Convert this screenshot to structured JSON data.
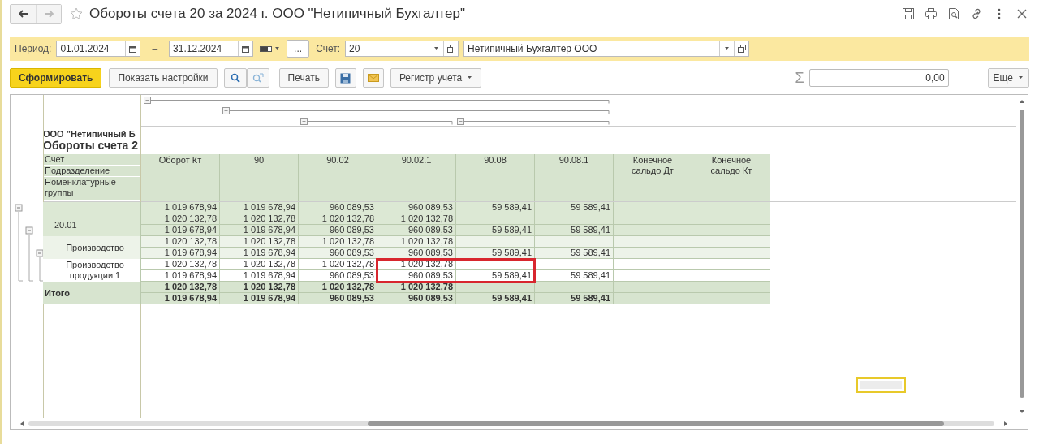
{
  "window": {
    "title": "Обороты счета 20 за 2024 г. ООО \"Нетипичный Бухгалтер\""
  },
  "filters": {
    "period_label": "Период:",
    "date_from": "01.01.2024",
    "separator": "–",
    "date_to": "31.12.2024",
    "more_button": "...",
    "account_label": "Счет:",
    "account": "20",
    "organization": "Нетипичный Бухгалтер ООО"
  },
  "toolbar": {
    "buttons": [
      {
        "kind": "primary",
        "label": "Сформировать"
      },
      {
        "kind": "text",
        "label": "Показать настройки"
      },
      {
        "kind": "search"
      },
      {
        "kind": "findnext"
      },
      {
        "kind": "text",
        "label": "Печать"
      },
      {
        "kind": "save"
      },
      {
        "kind": "mail"
      },
      {
        "kind": "menu",
        "label": "Регистр учета"
      }
    ],
    "sum_sign": "Σ",
    "sum_value": "0,00",
    "more_menu": "Еще"
  },
  "report": {
    "company": "ООО \"Нетипичный Б",
    "title": "Обороты счета 2",
    "row_headers": [
      "Счет",
      "Подразделение",
      "Номенклатурные группы"
    ],
    "columns": [
      "Оборот Кт",
      "90",
      "90.02",
      "90.02.1",
      "90.08",
      "90.08.1",
      "Конечное сальдо Дт",
      "Конечное сальдо Кт"
    ],
    "rows": [
      {
        "expanded": true,
        "lines": [
          [
            "1 019 678,94",
            "1 019 678,94",
            "960 089,53",
            "960 089,53",
            "59 589,41",
            "59 589,41"
          ]
        ],
        "children": [
          {
            "label": "20.01",
            "expanded": true,
            "lines": [
              [
                "1 020 132,78",
                "1 020 132,78",
                "1 020 132,78",
                "1 020 132,78"
              ],
              [
                "1 019 678,94",
                "1 019 678,94",
                "960 089,53",
                "960 089,53",
                "59 589,41",
                "59 589,41"
              ]
            ],
            "children": [
              {
                "label": "Производство",
                "expanded": true,
                "lines": [
                  [
                    "1 020 132,78",
                    "1 020 132,78",
                    "1 020 132,78",
                    "1 020 132,78"
                  ],
                  [
                    "1 019 678,94",
                    "1 019 678,94",
                    "960 089,53",
                    "960 089,53",
                    "59 589,41",
                    "59 589,41"
                  ]
                ],
                "children": [
                  {
                    "label": "Производство продукции 1",
                    "lines": [
                      [
                        "1 020 132,78",
                        "1 020 132,78",
                        "1 020 132,78",
                        "1 020 132,78"
                      ],
                      [
                        "1 019 678,94",
                        "1 019 678,94",
                        "960 089,53",
                        "960 089,53",
                        "59 589,41",
                        "59 589,41"
                      ]
                    ]
                  }
                ]
              }
            ]
          }
        ]
      }
    ],
    "total": {
      "label": "Итого",
      "lines": [
        [
          "1 020 132,78",
          "1 020 132,78",
          "1 020 132,78",
          "1 020 132,78"
        ],
        [
          "1 019 678,94",
          "1 019 678,94",
          "960 089,53",
          "960 089,53",
          "59 589,41",
          "59 589,41"
        ]
      ]
    }
  }
}
